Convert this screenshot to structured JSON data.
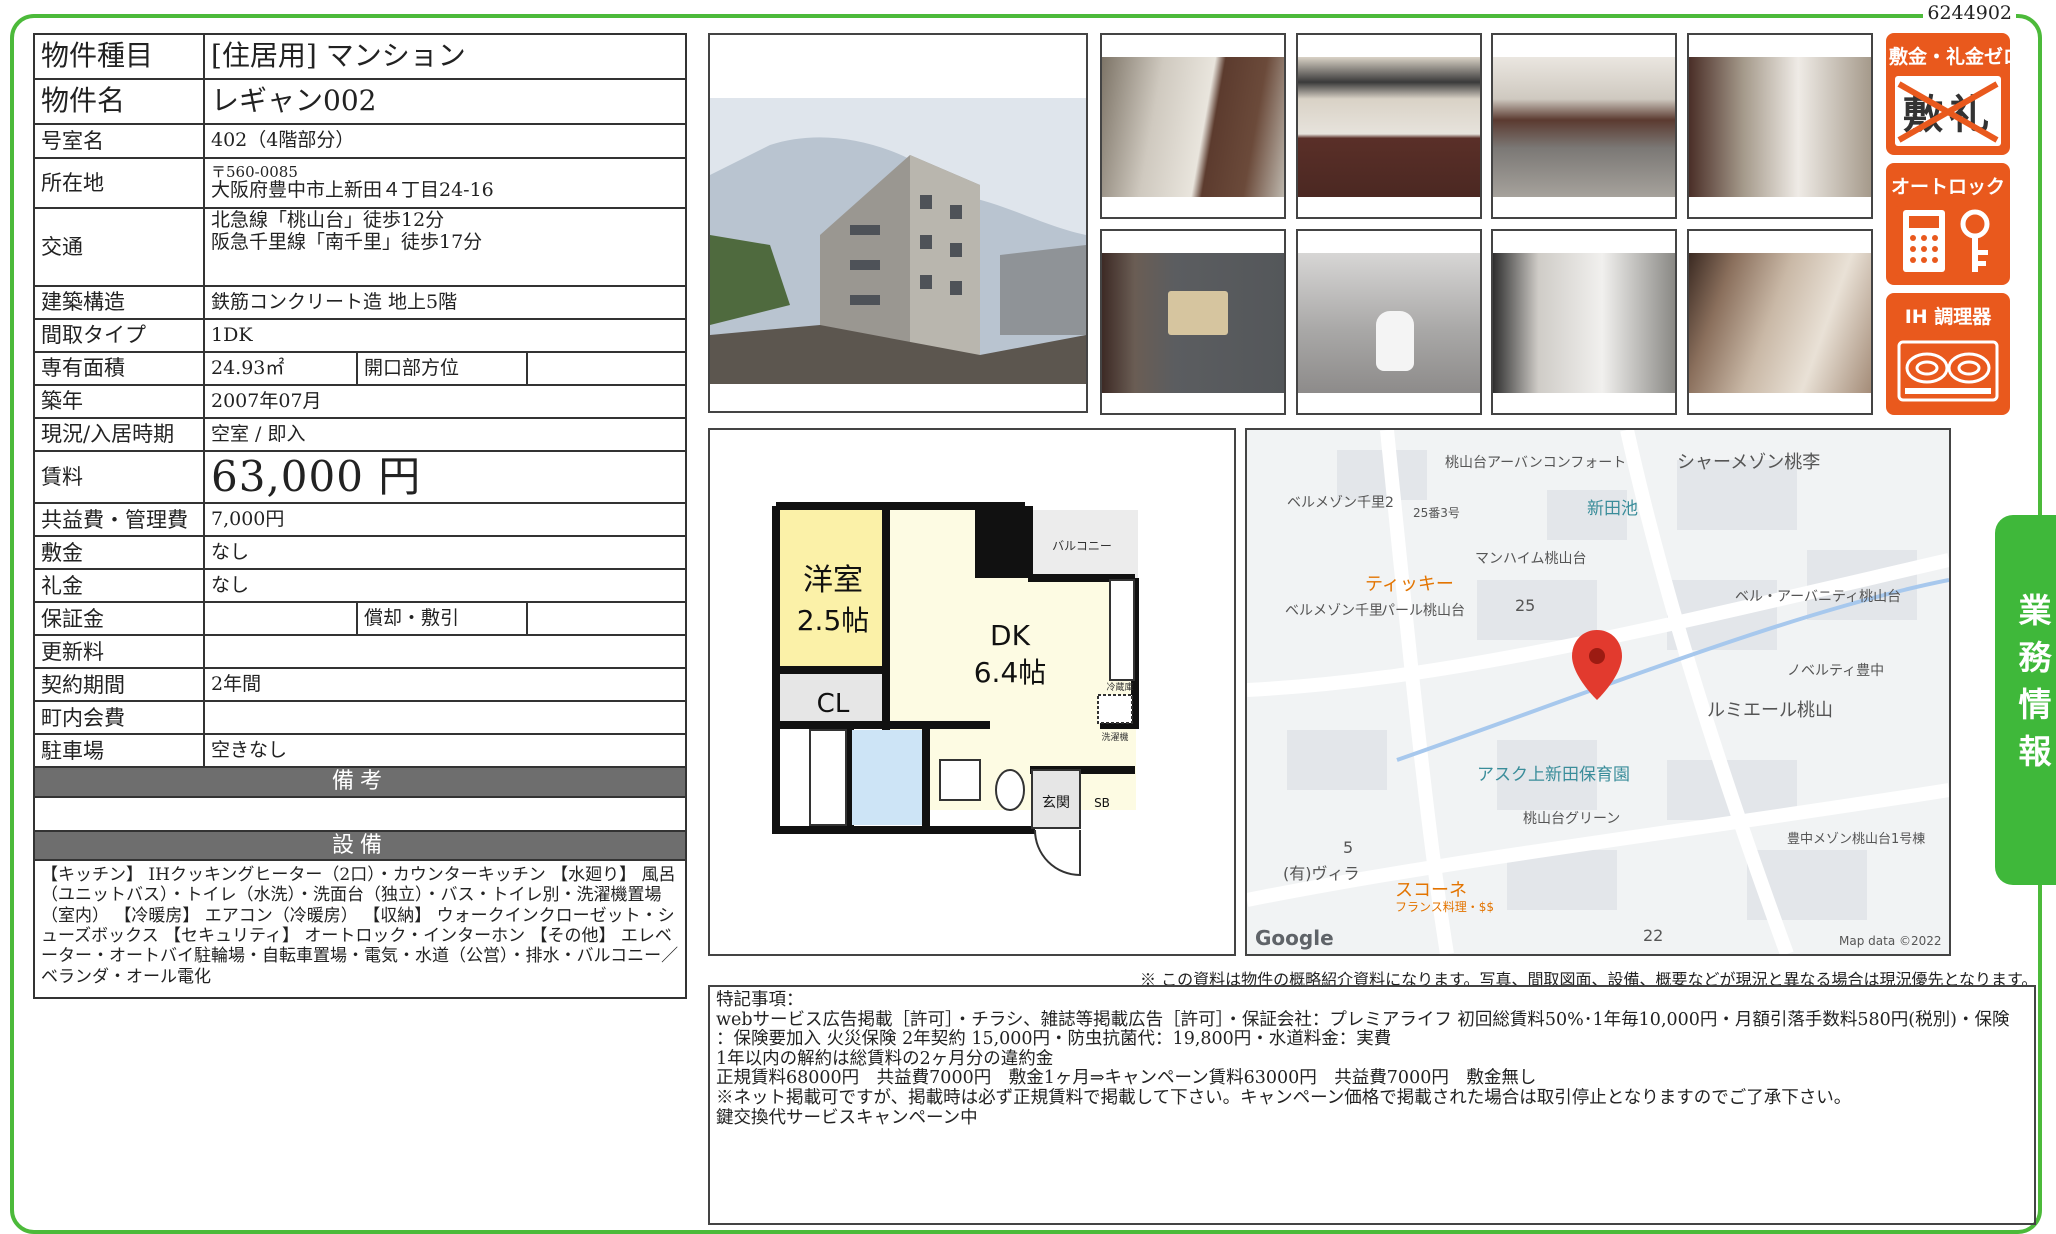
{
  "doc_id": "6244902",
  "property": {
    "rows": [
      {
        "label": "物件種目",
        "value": "[住居用]  マンション"
      },
      {
        "label": "物件名",
        "value": "レギャン002"
      },
      {
        "label": "号室名",
        "value": "402（4階部分）"
      },
      {
        "label": "所在地",
        "postal": "〒560-0085",
        "value": "大阪府豊中市上新田４丁目24-16"
      },
      {
        "label": "交通",
        "line1": "北急線「桃山台」徒歩12分",
        "line2": "阪急千里線「南千里」徒歩17分"
      },
      {
        "label": "建築構造",
        "value": "鉄筋コンクリート造 地上5階"
      },
      {
        "label": "間取タイプ",
        "value": "1DK"
      },
      {
        "label": "専有面積",
        "value": "24.93㎡",
        "sub_label": "開口部方位",
        "sub_value": ""
      },
      {
        "label": "築年",
        "value": "2007年07月"
      },
      {
        "label": "現況/入居時期",
        "value": "空室 / 即入"
      },
      {
        "label": "賃料",
        "value": "63,000 円"
      },
      {
        "label": "共益費・管理費",
        "value": "7,000円"
      },
      {
        "label": "敷金",
        "value": "なし"
      },
      {
        "label": "礼金",
        "value": "なし"
      },
      {
        "label": "保証金",
        "value": "",
        "sub_label": "償却・敷引",
        "sub_value": ""
      },
      {
        "label": "更新料",
        "value": ""
      },
      {
        "label": "契約期間",
        "value": "2年間"
      },
      {
        "label": "町内会費",
        "value": ""
      },
      {
        "label": "駐車場",
        "value": "空きなし"
      }
    ],
    "remarks_header": "備考",
    "remarks_body": "",
    "facilities_header": "設備",
    "facilities": "【キッチン】 IHクッキングヒーター（2口）・カウンターキッチン 【水廻り】 風呂（ユニットバス）・トイレ（水洗）・洗面台（独立）・バス・トイレ別・洗濯機置場（室内） 【冷暖房】 エアコン（冷暖房） 【収納】 ウォークインクローゼット・シューズボックス 【セキュリティ】 オートロック・インターホン 【その他】 エレベーター・オートバイ駐輪場・自転車置場・電気・水道（公営）・排水・バルコニー／ベランダ・オール電化"
  },
  "badges": [
    {
      "label": "敷金・礼金ゼロ",
      "icon": "no-deposit-icon"
    },
    {
      "label": "オートロック",
      "icon": "auto-lock-icon"
    },
    {
      "label": "IH 調理器",
      "icon": "ih-stove-icon"
    }
  ],
  "floorplan": {
    "room1": "洋室",
    "room1_size": "2.5帖",
    "room2": "DK",
    "room2_size": "6.4帖",
    "closet": "CL",
    "balcony": "バルコニー",
    "entrance": "玄関",
    "shoebox": "SB",
    "fridge": "冷蔵庫",
    "washer": "洗濯機"
  },
  "map": {
    "labels": [
      "桃山台アーバンコンフォート",
      "新田池",
      "シャーメゾン桃李",
      "ベルメゾン千里2",
      "25番3号",
      "マンハイム桃山台",
      "ティッキー",
      "ベルメゾン千里",
      "パール桃山台",
      "25",
      "ベル・アーバニティ桃山台",
      "ノベルティ豊中",
      "ルミエール桃山",
      "アスク上新田保育園",
      "桃山台グリーン",
      "豊中メゾン桃山台1号棟",
      "5",
      "(有)ヴィラ",
      "スコーネ",
      "フランス料理・$$",
      "22"
    ],
    "google": "Google",
    "copyright": "Map data ©2022"
  },
  "notice": "※ この資料は物件の概略紹介資料になります。写真、間取図面、設備、概要などが現況と異なる場合は現況優先となります。",
  "special_notes": {
    "title": "特記事項：",
    "lines": [
      "webサービス広告掲載［許可］・チラシ、雑誌等掲載広告［許可］・保証会社：プレミアライフ 初回総賃料50%･1年毎10,000円・月額引落手数料580円(税別)・保険",
      "：保険要加入 火災保険 2年契約 15,000円・防虫抗菌代：19,800円・水道料金：実費",
      "1年以内の解約は総賃料の2ヶ月分の違約金",
      "正規賃料68000円　共益費7000円　敷金1ヶ月⇒キャンペーン賃料63000円　共益費7000円　敷金無し",
      "※ネット掲載可ですが、掲載時は必ず正規賃料で掲載して下さい。キャンペーン価格で掲載された場合は取引停止となりますのでご了承下さい。",
      "鍵交換代サービスキャンペーン中"
    ]
  },
  "side_tab": "業務情報",
  "colors": {
    "frame": "#4cba3a",
    "badge": "#e9591d",
    "section": "#6e6e6e"
  }
}
